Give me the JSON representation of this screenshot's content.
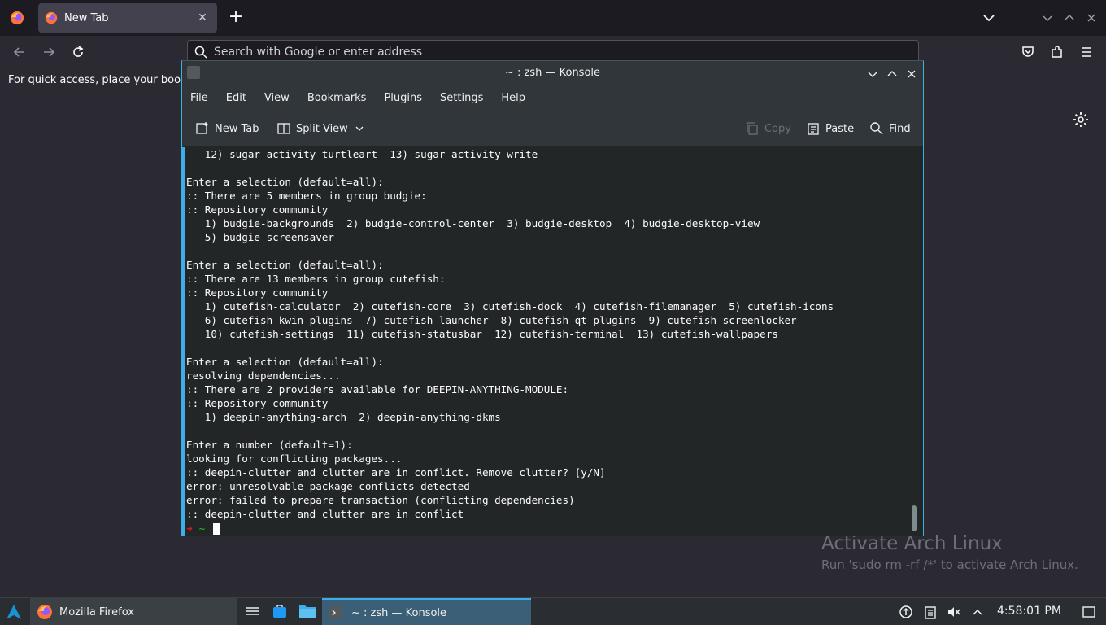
{
  "firefox": {
    "tab": {
      "title": "New Tab",
      "close": "✕"
    },
    "new_tab_glyph": "+",
    "urlbar": {
      "placeholder": "Search with Google or enter address"
    },
    "bookmarks_hint": "For quick access, place your bookr"
  },
  "konsole": {
    "title": "~ : zsh — Konsole",
    "menu": [
      "File",
      "Edit",
      "View",
      "Bookmarks",
      "Plugins",
      "Settings",
      "Help"
    ],
    "toolbar": {
      "new_tab": "New Tab",
      "split_view": "Split View",
      "copy": "Copy",
      "paste": "Paste",
      "find": "Find"
    },
    "terminal_output": [
      "   12) sugar-activity-turtleart  13) sugar-activity-write",
      "",
      "Enter a selection (default=all):",
      ":: There are 5 members in group budgie:",
      ":: Repository community",
      "   1) budgie-backgrounds  2) budgie-control-center  3) budgie-desktop  4) budgie-desktop-view",
      "   5) budgie-screensaver",
      "",
      "Enter a selection (default=all):",
      ":: There are 13 members in group cutefish:",
      ":: Repository community",
      "   1) cutefish-calculator  2) cutefish-core  3) cutefish-dock  4) cutefish-filemanager  5) cutefish-icons",
      "   6) cutefish-kwin-plugins  7) cutefish-launcher  8) cutefish-qt-plugins  9) cutefish-screenlocker",
      "   10) cutefish-settings  11) cutefish-statusbar  12) cutefish-terminal  13) cutefish-wallpapers",
      "",
      "Enter a selection (default=all):",
      "resolving dependencies...",
      ":: There are 2 providers available for DEEPIN-ANYTHING-MODULE:",
      ":: Repository community",
      "   1) deepin-anything-arch  2) deepin-anything-dkms",
      "",
      "Enter a number (default=1):",
      "looking for conflicting packages...",
      ":: deepin-clutter and clutter are in conflict. Remove clutter? [y/N]",
      "error: unresolvable package conflicts detected",
      "error: failed to prepare transaction (conflicting dependencies)",
      ":: deepin-clutter and clutter are in conflict"
    ],
    "prompt": {
      "arrow": "➜",
      "dir": "~"
    }
  },
  "watermark": {
    "title": "Activate Arch Linux",
    "subtitle": "Run 'sudo rm -rf /*' to activate Arch Linux."
  },
  "taskbar": {
    "tasks": {
      "firefox": "Mozilla Firefox",
      "konsole": "~ : zsh — Konsole"
    },
    "clock": "4:58:01 PM"
  },
  "colors": {
    "accent": "#3daee9",
    "firefox_bg": "#2b2a33",
    "terminal_bg": "#232627"
  }
}
